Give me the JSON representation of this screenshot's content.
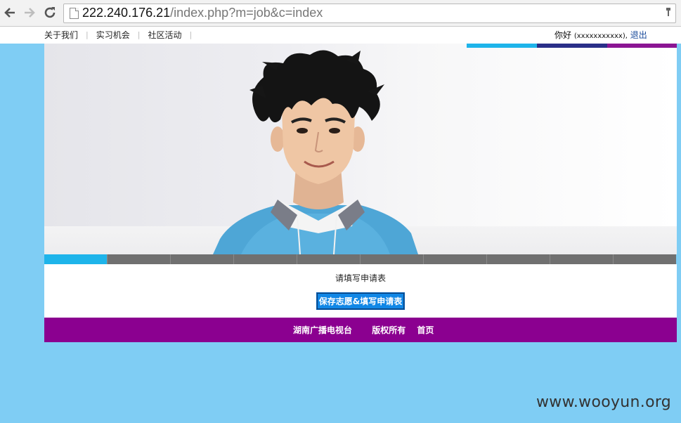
{
  "browser": {
    "url_host": "222.240.176.21",
    "url_path": "/index.php?m=job&c=index",
    "icons": [
      "back-arrow-icon",
      "forward-arrow-icon",
      "reload-icon",
      "page-icon"
    ]
  },
  "topnav": {
    "items": [
      "关于我们",
      "实习机会",
      "社区活动"
    ],
    "greeting": "你好",
    "username": "(xxxxxxxxxxx),",
    "logout": "退出"
  },
  "banner": {
    "stripe_colors": [
      "#1eb4ea",
      "#2a2f88",
      "#8b1593"
    ],
    "active_slide": 1,
    "slide_count": 10
  },
  "content": {
    "apply_label": "请填写申请表",
    "save_button": "保存志愿&填写申请表"
  },
  "footer": {
    "company": "湖南广播电视台",
    "copyright": "版权所有",
    "home": "首页"
  },
  "colors": {
    "page_bg": "#7fcdf4",
    "footer_bg": "#8b0090",
    "button_bg": "#1187e6",
    "active_tab": "#1eb4ea"
  },
  "watermark": "www.wooyun.org"
}
